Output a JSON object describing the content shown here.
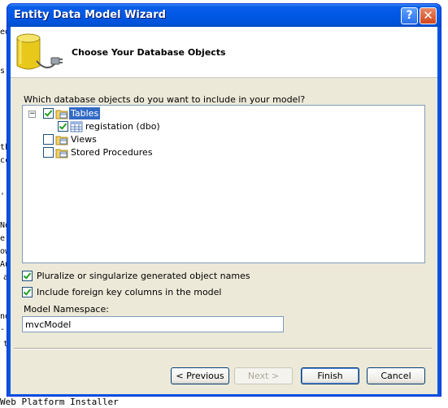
{
  "background": {
    "left_fragments": [
      "ed",
      "s",
      "th",
      "cc",
      "',",
      "No",
      "e",
      "ow",
      "Au",
      "a",
      "nd",
      "-",
      "t"
    ],
    "bottom_text": "Web Platform Installer"
  },
  "window": {
    "title": "Entity Data Model Wizard",
    "help_label": "?",
    "close_label": "✕"
  },
  "header": {
    "title": "Choose Your Database Objects",
    "icon": "database-plug-icon"
  },
  "prompt": "Which database objects do you want to include in your model?",
  "tree": {
    "tables": {
      "label": "Tables",
      "checked": true,
      "expanded": true,
      "selected": true
    },
    "table_items": [
      {
        "label": "registation (dbo)",
        "checked": true
      }
    ],
    "views": {
      "label": "Views",
      "checked": false
    },
    "stored_procedures": {
      "label": "Stored Procedures",
      "checked": false
    }
  },
  "options": {
    "pluralize": {
      "label": "Pluralize or singularize generated object names",
      "checked": true
    },
    "foreign_keys": {
      "label": "Include foreign key columns in the model",
      "checked": true
    }
  },
  "namespace": {
    "label": "Model Namespace:",
    "value": "mvcModel"
  },
  "buttons": {
    "previous": "< Previous",
    "next": "Next >",
    "finish": "Finish",
    "cancel": "Cancel"
  },
  "colors": {
    "titlebar": "#0058e6",
    "dialog_bg": "#ece9d8",
    "selection": "#316ac5"
  }
}
